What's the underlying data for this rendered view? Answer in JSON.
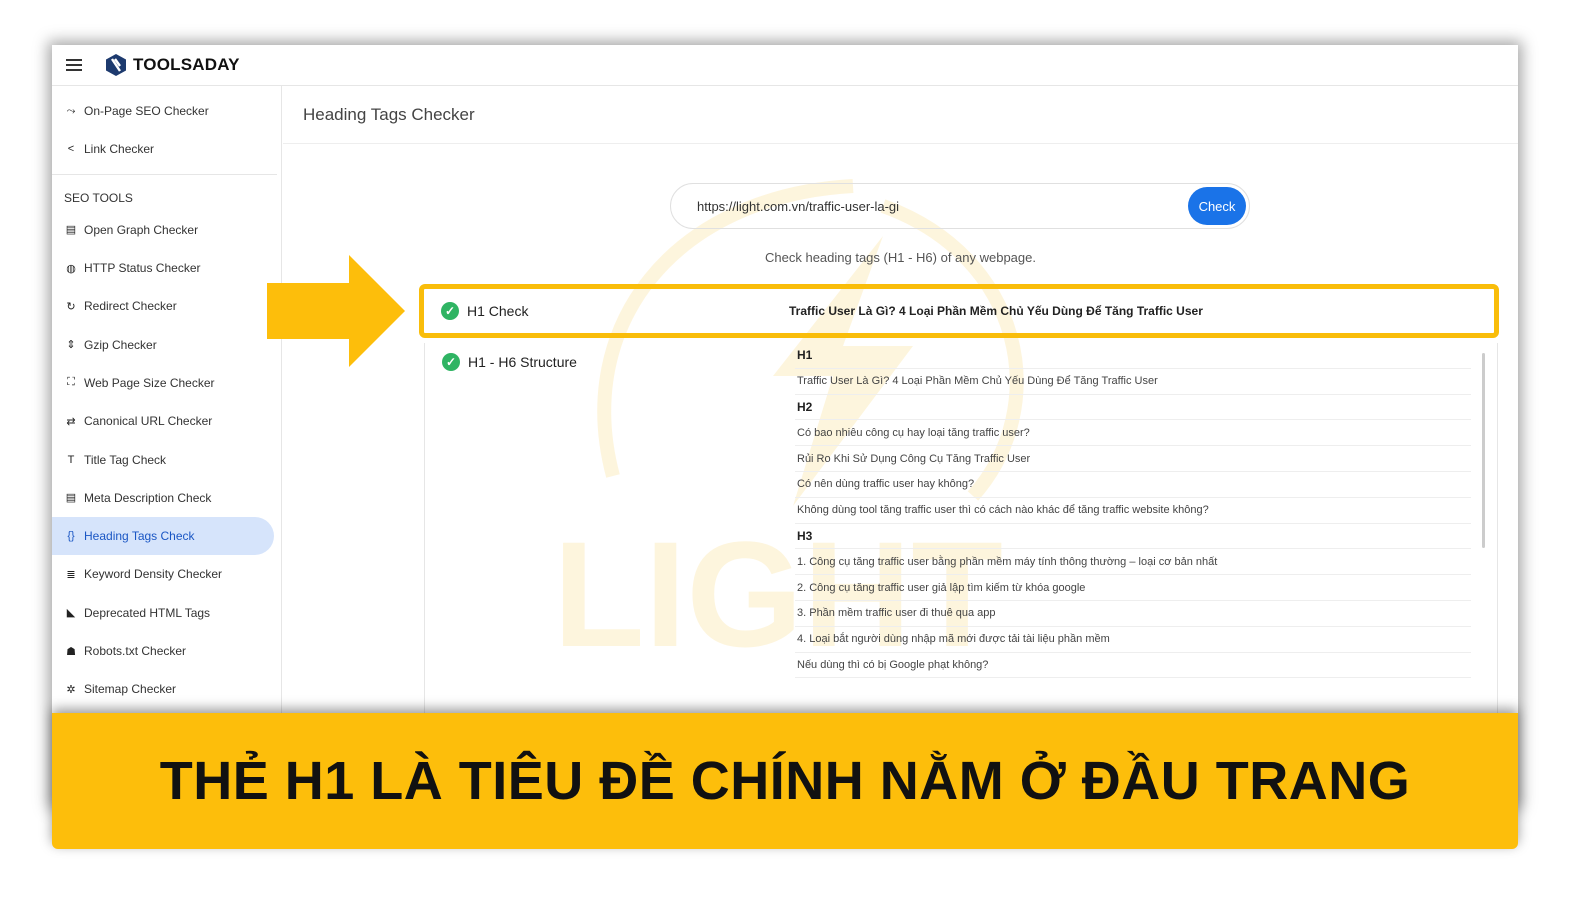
{
  "app": {
    "brand": "TOOLSADAY",
    "watermark": "LIGHT Nhanh - Chuẩn - Đẹp"
  },
  "sidebar": {
    "top_items": [
      {
        "label": "On-Page SEO Checker",
        "icon": "trend-icon"
      },
      {
        "label": "Link Checker",
        "icon": "share-icon"
      }
    ],
    "section": "SEO TOOLS",
    "items": [
      {
        "label": "Open Graph Checker",
        "icon": "document-icon"
      },
      {
        "label": "HTTP Status Checker",
        "icon": "globe-icon"
      },
      {
        "label": "Redirect Checker",
        "icon": "refresh-icon"
      },
      {
        "label": "Gzip Checker",
        "icon": "compress-icon"
      },
      {
        "label": "Web Page Size Checker",
        "icon": "expand-icon"
      },
      {
        "label": "Canonical URL Checker",
        "icon": "swap-icon"
      },
      {
        "label": "Title Tag Check",
        "icon": "text-icon"
      },
      {
        "label": "Meta Description Check",
        "icon": "document-icon"
      },
      {
        "label": "Heading Tags Check",
        "icon": "code-icon",
        "active": true
      },
      {
        "label": "Keyword Density Checker",
        "icon": "list-icon"
      },
      {
        "label": "Deprecated HTML Tags",
        "icon": "code-off-icon"
      },
      {
        "label": "Robots.txt Checker",
        "icon": "robot-icon"
      },
      {
        "label": "Sitemap Checker",
        "icon": "sitemap-icon"
      }
    ]
  },
  "main": {
    "title": "Heading Tags Checker",
    "url": "https://light.com.vn/traffic-user-la-gi",
    "check_button": "Check",
    "hint": "Check heading tags (H1 - H6) of any webpage.",
    "h1_check": {
      "label": "H1 Check",
      "value": "Traffic User Là Gì? 4 Loại Phần Mềm Chủ Yếu Dùng Để Tăng Traffic User"
    },
    "structure": {
      "label": "H1 - H6 Structure",
      "rows": [
        {
          "text": "H1",
          "heading": true
        },
        {
          "text": "Traffic User Là Gì? 4 Loại Phần Mềm Chủ Yếu Dùng Để Tăng Traffic User"
        },
        {
          "text": "H2",
          "heading": true
        },
        {
          "text": "Có bao nhiêu công cụ hay loại tăng traffic user?"
        },
        {
          "text": "Rủi Ro Khi Sử Dụng Công Cụ Tăng Traffic User"
        },
        {
          "text": "Có nên dùng traffic user hay không?"
        },
        {
          "text": "Không dùng tool tăng traffic user thì có cách nào khác để tăng traffic website không?"
        },
        {
          "text": "H3",
          "heading": true
        },
        {
          "text": "1. Công cụ tăng traffic user bằng phần mềm máy tính thông thường – loại cơ bản nhất"
        },
        {
          "text": "2. Công cụ tăng traffic user giả lập tìm kiếm từ khóa google"
        },
        {
          "text": "3. Phần mềm traffic user đi thuê qua app"
        },
        {
          "text": "4. Loại bắt người dùng nhập mã mới được tải tài liệu phần mềm"
        },
        {
          "text": "Nếu dùng thì có bị Google phạt không?"
        }
      ]
    }
  },
  "banner": {
    "text": "THẺ H1 LÀ TIÊU ĐỀ CHÍNH NẰM Ở ĐẦU TRANG"
  },
  "colors": {
    "accent": "#fdbe0b",
    "primary": "#1a73e8",
    "success": "#2fb463",
    "active_bg": "#d6e4fb"
  }
}
